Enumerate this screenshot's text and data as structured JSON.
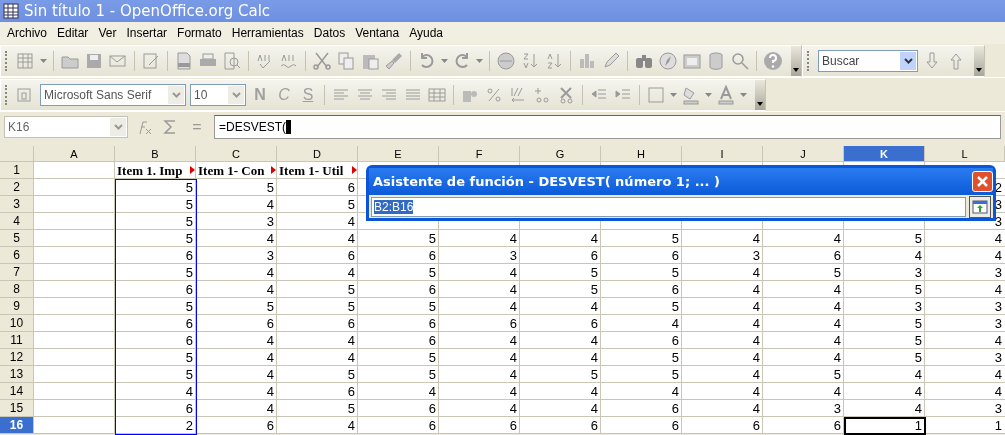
{
  "window": {
    "title": "Sin título 1 - OpenOffice.org Calc"
  },
  "menu": [
    "Archivo",
    "Editar",
    "Ver",
    "Insertar",
    "Formato",
    "Herramientas",
    "Datos",
    "Ventana",
    "Ayuda"
  ],
  "search": {
    "value": "Buscar"
  },
  "format_bar": {
    "font": "Microsoft Sans Serif",
    "size": "10",
    "bold": "N",
    "italic": "C",
    "underline": "S"
  },
  "formula_bar": {
    "cell": "K16",
    "equals": "=",
    "formula": "=DESVEST("
  },
  "columns": [
    {
      "label": "A",
      "selected": false,
      "referenced": false
    },
    {
      "label": "B",
      "selected": false,
      "referenced": true
    },
    {
      "label": "C",
      "selected": false,
      "referenced": false
    },
    {
      "label": "D",
      "selected": false,
      "referenced": false
    },
    {
      "label": "E",
      "selected": false,
      "referenced": false
    },
    {
      "label": "F",
      "selected": false,
      "referenced": false
    },
    {
      "label": "G",
      "selected": false,
      "referenced": false
    },
    {
      "label": "H",
      "selected": false,
      "referenced": false
    },
    {
      "label": "I",
      "selected": false,
      "referenced": false
    },
    {
      "label": "J",
      "selected": false,
      "referenced": false
    },
    {
      "label": "K",
      "selected": true,
      "referenced": false
    },
    {
      "label": "L",
      "selected": false,
      "referenced": false
    }
  ],
  "rows": [
    {
      "label": "1",
      "selected": false,
      "kind": "header",
      "cells": [
        null,
        {
          "text": "Item 1. Imp",
          "overflow": true
        },
        {
          "text": "Item 1- Con",
          "overflow": true
        },
        {
          "text": "Item 1- Util",
          "overflow": true
        },
        null,
        null,
        null,
        null,
        null,
        null,
        null,
        null
      ]
    },
    {
      "label": "2",
      "selected": false,
      "kind": "data",
      "cells": [
        null,
        "5",
        "5",
        "6",
        null,
        null,
        null,
        null,
        null,
        null,
        null,
        "2"
      ]
    },
    {
      "label": "3",
      "selected": false,
      "kind": "data",
      "cells": [
        null,
        "5",
        "4",
        "5",
        null,
        null,
        null,
        null,
        null,
        null,
        null,
        "3"
      ]
    },
    {
      "label": "4",
      "selected": false,
      "kind": "data",
      "cells": [
        null,
        "5",
        "3",
        "4",
        null,
        null,
        null,
        null,
        null,
        null,
        null,
        "3"
      ]
    },
    {
      "label": "5",
      "selected": false,
      "kind": "data",
      "cells": [
        null,
        "5",
        "4",
        "4",
        "5",
        "4",
        "4",
        "5",
        "4",
        "4",
        "5",
        "4"
      ]
    },
    {
      "label": "6",
      "selected": false,
      "kind": "data",
      "cells": [
        null,
        "6",
        "3",
        "6",
        "6",
        "3",
        "6",
        "6",
        "3",
        "6",
        "4",
        "4"
      ]
    },
    {
      "label": "7",
      "selected": false,
      "kind": "data",
      "cells": [
        null,
        "5",
        "4",
        "4",
        "5",
        "4",
        "5",
        "5",
        "4",
        "5",
        "3",
        "3"
      ]
    },
    {
      "label": "8",
      "selected": false,
      "kind": "data",
      "cells": [
        null,
        "6",
        "4",
        "5",
        "6",
        "4",
        "5",
        "6",
        "4",
        "4",
        "5",
        "4"
      ]
    },
    {
      "label": "9",
      "selected": false,
      "kind": "data",
      "cells": [
        null,
        "5",
        "5",
        "5",
        "5",
        "4",
        "4",
        "5",
        "4",
        "4",
        "3",
        "3"
      ]
    },
    {
      "label": "10",
      "selected": false,
      "kind": "data",
      "cells": [
        null,
        "6",
        "6",
        "6",
        "6",
        "6",
        "6",
        "4",
        "4",
        "4",
        "5",
        "3"
      ]
    },
    {
      "label": "11",
      "selected": false,
      "kind": "data",
      "cells": [
        null,
        "6",
        "4",
        "4",
        "6",
        "4",
        "4",
        "6",
        "4",
        "4",
        "5",
        "4"
      ]
    },
    {
      "label": "12",
      "selected": false,
      "kind": "data",
      "cells": [
        null,
        "5",
        "4",
        "4",
        "5",
        "4",
        "4",
        "5",
        "4",
        "4",
        "5",
        "3"
      ]
    },
    {
      "label": "13",
      "selected": false,
      "kind": "data",
      "cells": [
        null,
        "5",
        "4",
        "5",
        "5",
        "4",
        "5",
        "5",
        "4",
        "5",
        "4",
        "4"
      ]
    },
    {
      "label": "14",
      "selected": false,
      "kind": "data",
      "cells": [
        null,
        "4",
        "4",
        "6",
        "4",
        "4",
        "4",
        "4",
        "4",
        "4",
        "4",
        "4"
      ]
    },
    {
      "label": "15",
      "selected": false,
      "kind": "data",
      "cells": [
        null,
        "6",
        "4",
        "5",
        "6",
        "4",
        "4",
        "6",
        "4",
        "3",
        "4",
        "3"
      ]
    },
    {
      "label": "16",
      "selected": true,
      "kind": "data",
      "cells": [
        null,
        "2",
        "6",
        "4",
        "6",
        "6",
        "6",
        "6",
        "6",
        "6",
        "1",
        "1"
      ]
    }
  ],
  "dialog": {
    "title": "Asistente de función - DESVEST( número 1; ... )",
    "value": "B2:B16"
  }
}
